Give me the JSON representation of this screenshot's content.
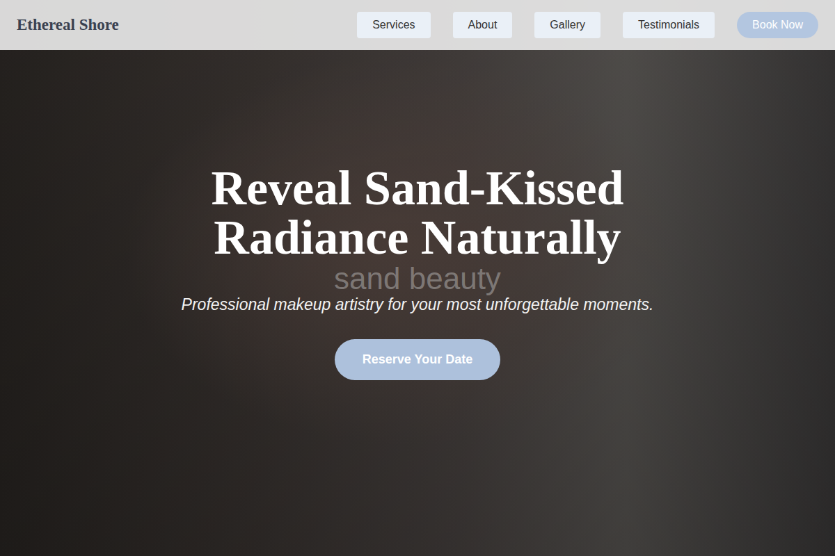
{
  "nav": {
    "logo": "Ethereal Shore",
    "links": [
      {
        "label": "Services"
      },
      {
        "label": "About"
      },
      {
        "label": "Gallery"
      },
      {
        "label": "Testimonials"
      }
    ],
    "cta": "Book Now"
  },
  "hero": {
    "title_lines": [
      "Reveal Sand-Kissed",
      "Radiance Naturally"
    ],
    "watermark": "sand beauty",
    "subtitle": "Professional makeup artistry for your most unforgettable moments.",
    "button": "Reserve Your Date"
  }
}
